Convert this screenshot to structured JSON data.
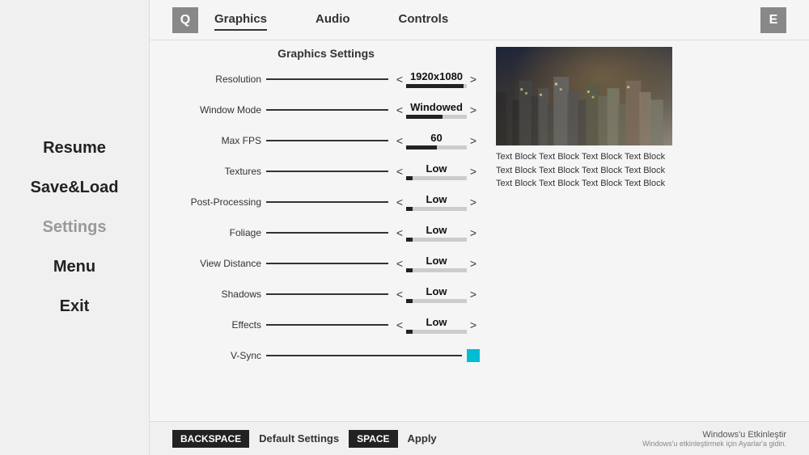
{
  "sidebar": {
    "items": [
      {
        "label": "Resume",
        "active": false
      },
      {
        "label": "Save&Load",
        "active": false
      },
      {
        "label": "Settings",
        "active": true
      },
      {
        "label": "Menu",
        "active": false
      },
      {
        "label": "Exit",
        "active": false
      }
    ]
  },
  "nav": {
    "q_btn": "Q",
    "e_btn": "E",
    "tabs": [
      {
        "label": "Graphics",
        "active": true
      },
      {
        "label": "Audio",
        "active": false
      },
      {
        "label": "Controls",
        "active": false
      }
    ]
  },
  "graphics": {
    "title": "Graphics Settings",
    "settings": [
      {
        "label": "Resolution",
        "value": "1920x1080",
        "fill_pct": 95
      },
      {
        "label": "Window Mode",
        "value": "Windowed",
        "fill_pct": 60
      },
      {
        "label": "Max FPS",
        "value": "60",
        "fill_pct": 50
      },
      {
        "label": "Textures",
        "value": "Low",
        "fill_pct": 10
      },
      {
        "label": "Post-Processing",
        "value": "Low",
        "fill_pct": 10
      },
      {
        "label": "Foliage",
        "value": "Low",
        "fill_pct": 10
      },
      {
        "label": "View Distance",
        "value": "Low",
        "fill_pct": 10
      },
      {
        "label": "Shadows",
        "value": "Low",
        "fill_pct": 10
      },
      {
        "label": "Effects",
        "value": "Low",
        "fill_pct": 10
      }
    ],
    "vsync_label": "V-Sync",
    "vsync_enabled": true
  },
  "preview": {
    "text": "Text Block Text Block Text Block Text Block Text Block Text Block Text Block Text Block Text Block Text Block Text Block Text Block"
  },
  "bottom_bar": {
    "backspace_label": "BACKSPACE",
    "default_label": "Default Settings",
    "space_label": "SPACE",
    "apply_label": "Apply",
    "windows_title": "Windows'u Etkinleştir",
    "windows_sub": "Windows'u etkinleştirmek için Ayarlar'a gidin."
  }
}
